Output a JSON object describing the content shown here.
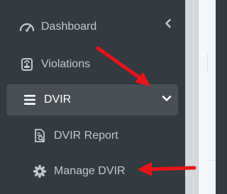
{
  "sidebar": {
    "items": [
      {
        "label": "Dashboard",
        "icon": "speedometer-icon"
      },
      {
        "label": "Violations",
        "icon": "tachograph-icon"
      },
      {
        "label": "DVIR",
        "icon": "menu-bars-icon",
        "expanded": true,
        "children": [
          {
            "label": "DVIR Report",
            "icon": "report-search-icon"
          },
          {
            "label": "Manage DVIR",
            "icon": "gear-icon"
          }
        ]
      }
    ]
  },
  "colors": {
    "sidebar_bg": "#343a40",
    "text": "#c2c7d0",
    "active_text": "#ffffff",
    "annotation_arrow": "#e8141a"
  }
}
